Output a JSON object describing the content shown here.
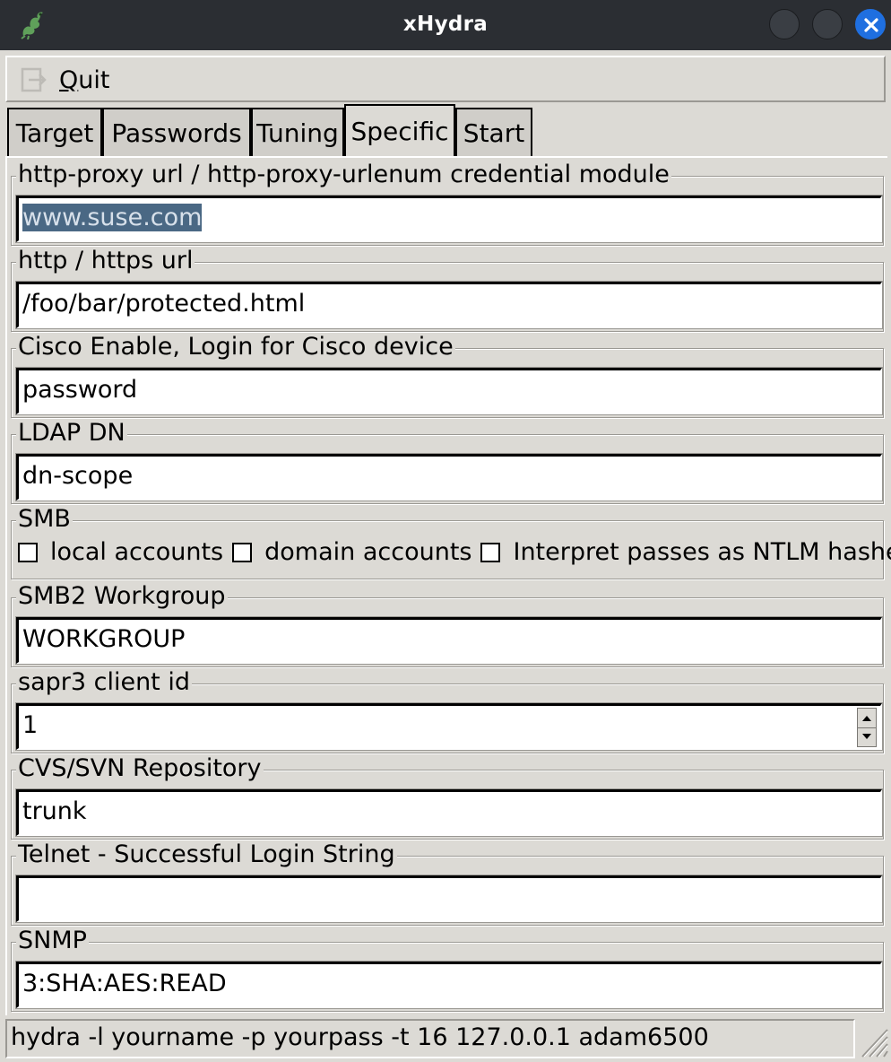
{
  "window": {
    "title": "xHydra"
  },
  "menu": {
    "quit_underlined": "Q",
    "quit_rest": "uit"
  },
  "tabs": [
    {
      "label": "Target"
    },
    {
      "label": "Passwords"
    },
    {
      "label": "Tuning"
    },
    {
      "label": "Specific",
      "active": true
    },
    {
      "label": "Start"
    }
  ],
  "groups": {
    "http_proxy": {
      "label": "http-proxy url / http-proxy-urlenum credential module",
      "value": "www.suse.com"
    },
    "http_url": {
      "label": "http / https url",
      "value": "/foo/bar/protected.html"
    },
    "cisco": {
      "label": "Cisco Enable, Login for Cisco device",
      "value": "password"
    },
    "ldap": {
      "label": "LDAP DN",
      "value": "dn-scope"
    },
    "smb": {
      "label": "SMB",
      "options": [
        {
          "label": "local accounts",
          "checked": false
        },
        {
          "label": "domain accounts",
          "checked": false
        },
        {
          "label": "Interpret passes as NTLM hashes",
          "checked": false
        }
      ]
    },
    "smb2": {
      "label": "SMB2 Workgroup",
      "value": "WORKGROUP"
    },
    "sapr3": {
      "label": "sapr3 client id",
      "value": "1"
    },
    "cvs": {
      "label": "CVS/SVN Repository",
      "value": "trunk"
    },
    "telnet": {
      "label": "Telnet - Successful Login String",
      "value": ""
    },
    "snmp": {
      "label": "SNMP",
      "value": "3:SHA:AES:READ"
    }
  },
  "status": {
    "command": "hydra -l yourname -p yourpass -t 16 127.0.0.1 adam6500"
  },
  "colors": {
    "titlebar": "#2b2e33",
    "close_button": "#1f6fe0",
    "background": "#dcdad5",
    "selection": "#4a6884"
  },
  "icons": {
    "app": "hydra-icon",
    "quit": "exit-icon",
    "close": "close-icon"
  }
}
